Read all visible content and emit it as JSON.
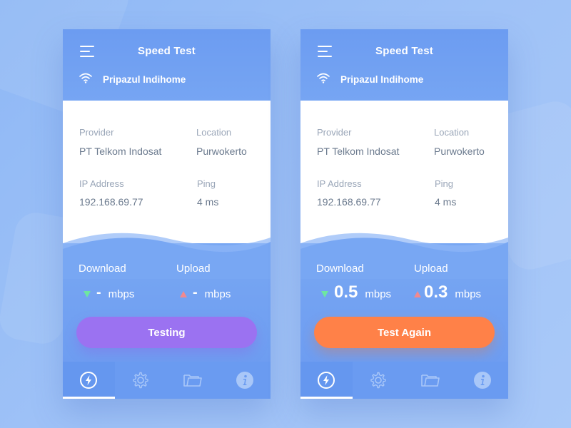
{
  "screens": [
    {
      "title": "Speed Test",
      "network": "Pripazul Indihome",
      "provider_label": "Provider",
      "provider": "PT Telkom Indosat",
      "location_label": "Location",
      "location": "Purwokerto",
      "ip_label": "IP Address",
      "ip": "192.168.69.77",
      "ping_label": "Ping",
      "ping": "4 ms",
      "download_label": "Download",
      "download_value": "-",
      "upload_label": "Upload",
      "upload_value": "-",
      "unit": "mbps",
      "button_label": "Testing",
      "button_color": "#9b72f1"
    },
    {
      "title": "Speed Test",
      "network": "Pripazul Indihome",
      "provider_label": "Provider",
      "provider": "PT Telkom Indosat",
      "location_label": "Location",
      "location": "Purwokerto",
      "ip_label": "IP Address",
      "ip": "192.168.69.77",
      "ping_label": "Ping",
      "ping": "4 ms",
      "download_label": "Download",
      "download_value": "0.5",
      "upload_label": "Upload",
      "upload_value": "0.3",
      "unit": "mbps",
      "button_label": "Test Again",
      "button_color": "#ff8148"
    }
  ],
  "tabs": [
    {
      "icon": "lightning-icon",
      "active": true
    },
    {
      "icon": "gear-icon",
      "active": false
    },
    {
      "icon": "folder-icon",
      "active": false
    },
    {
      "icon": "info-icon",
      "active": false
    }
  ],
  "colors": {
    "primary_blue": "#6e9df1",
    "download_arrow": "#6ee6a0",
    "upload_arrow": "#f2898e"
  }
}
